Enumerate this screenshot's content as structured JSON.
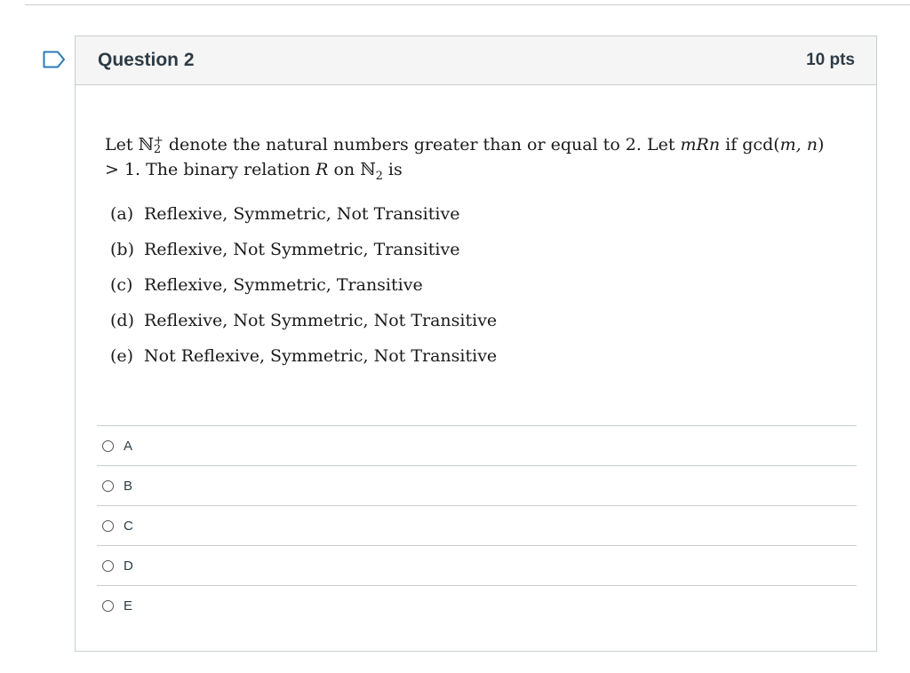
{
  "question": {
    "title": "Question 2",
    "points": "10 pts",
    "stem_part1": "Let ℕ",
    "stem_sup": "+",
    "stem_sub": "2",
    "stem_part2": " denote the natural numbers greater than or equal to 2. Let ",
    "stem_relation": "mRn",
    "stem_part3": " if gcd(",
    "stem_args": "m, n",
    "stem_part4": ") > 1. The binary relation ",
    "stem_R": "R",
    "stem_part5": " on ℕ",
    "stem_sub2": "2",
    "stem_part6": " is",
    "options": [
      {
        "label": "(a)",
        "text": "Reflexive, Symmetric, Not Transitive"
      },
      {
        "label": "(b)",
        "text": "Reflexive, Not Symmetric, Transitive"
      },
      {
        "label": "(c)",
        "text": "Reflexive, Symmetric, Transitive"
      },
      {
        "label": "(d)",
        "text": "Reflexive, Not Symmetric, Not Transitive"
      },
      {
        "label": "(e)",
        "text": "Not Reflexive, Symmetric, Not Transitive"
      }
    ]
  },
  "answers": [
    "A",
    "B",
    "C",
    "D",
    "E"
  ],
  "icons": {
    "flag": "bookmark-flag-icon",
    "radio": "radio-button-icon"
  },
  "colors": {
    "flag": "#2b7abc",
    "border": "#c7cdd1",
    "header_bg": "#f5f5f5",
    "text": "#2d3b45"
  }
}
